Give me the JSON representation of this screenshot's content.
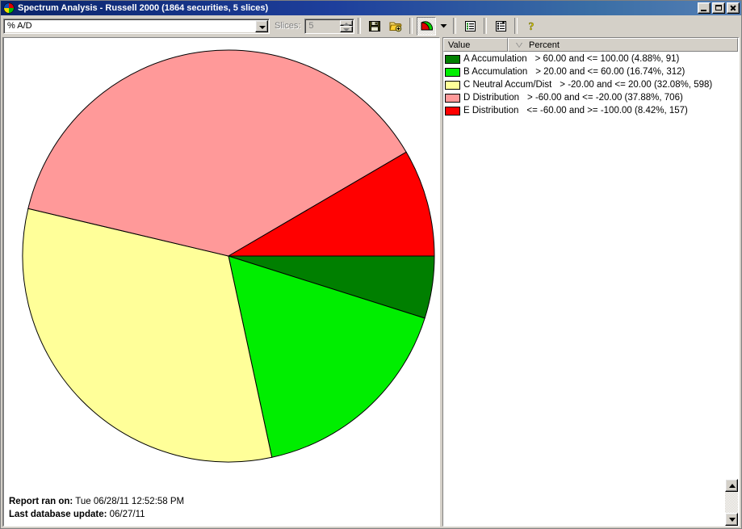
{
  "window": {
    "title": "Spectrum Analysis - Russell 2000 (1864 securities, 5 slices)",
    "icon": "pie-chart-icon",
    "minimize_label": "Minimize",
    "maximize_label": "Maximize",
    "close_label": "Close"
  },
  "toolbar": {
    "indicator_select_value": "% A/D",
    "slices_label": "Slices:",
    "slices_value": "5",
    "buttons": [
      {
        "name": "save-button",
        "icon": "floppy-disk-icon",
        "tooltip": "Save"
      },
      {
        "name": "open-button",
        "icon": "open-folder-icon",
        "tooltip": "Open"
      },
      {
        "name": "chart-type-button",
        "icon": "pie-chart-icon",
        "tooltip": "Chart Type",
        "pressed": true
      },
      {
        "name": "chart-type-dropdown",
        "icon": "chevron-down-icon",
        "tooltip": "Chart Type Options"
      },
      {
        "name": "list-view-button",
        "icon": "list-view-icon",
        "tooltip": "List View"
      },
      {
        "name": "report-button",
        "icon": "report-icon",
        "tooltip": "Report"
      },
      {
        "name": "help-button",
        "icon": "question-mark-icon",
        "tooltip": "Help"
      }
    ]
  },
  "legend": {
    "columns": {
      "value": "Value",
      "percent": "Percent",
      "sort_indicator": "sort-descending-icon"
    },
    "rows": [
      {
        "label": "A Accumulation",
        "range": "> 60.00 and <= 100.00 (4.88%, 91)",
        "color": "#007F00"
      },
      {
        "label": "B Accumulation",
        "range": "> 20.00 and <= 60.00 (16.74%, 312)",
        "color": "#00EE00"
      },
      {
        "label": "C Neutral Accum/Dist",
        "range": "> -20.00 and <= 20.00 (32.08%, 598)",
        "color": "#FFFF99"
      },
      {
        "label": "D Distribution",
        "range": "> -60.00 and <= -20.00 (37.88%, 706)",
        "color": "#FF9999"
      },
      {
        "label": "E Distribution",
        "range": "<= -60.00 and >= -100.00 (8.42%, 157)",
        "color": "#FF0000"
      }
    ]
  },
  "footer": {
    "report_label": "Report ran on:",
    "report_value": "Tue 06/28/11 12:52:58 PM",
    "database_label": "Last database update:",
    "database_value": "06/27/11"
  },
  "scrollbar": {
    "up_label": "Scroll up",
    "down_label": "Scroll down"
  },
  "chart_data": {
    "type": "pie",
    "title": "Spectrum Analysis - Russell 2000",
    "total_securities": 1864,
    "slice_count": 5,
    "start_angle_deg": 0,
    "direction": "clockwise",
    "center": [
      278,
      328
    ],
    "radius": 255,
    "categories": [
      "A Accumulation",
      "B Accumulation",
      "C Neutral Accum/Dist",
      "D Distribution",
      "E Distribution"
    ],
    "values": [
      4.88,
      16.74,
      32.08,
      37.88,
      8.42
    ],
    "counts": [
      91,
      312,
      598,
      706,
      157
    ],
    "colors": [
      "#007F00",
      "#00EE00",
      "#FFFF99",
      "#FF9999",
      "#FF0000"
    ],
    "ranges": [
      "> 60.00 and <= 100.00",
      "> 20.00 and <= 60.00",
      "> -20.00 and <= 20.00",
      "> -60.00 and <= -20.00",
      "<= -60.00 and >= -100.00"
    ],
    "ylabel": "",
    "xlabel": "",
    "legend_position": "right"
  }
}
